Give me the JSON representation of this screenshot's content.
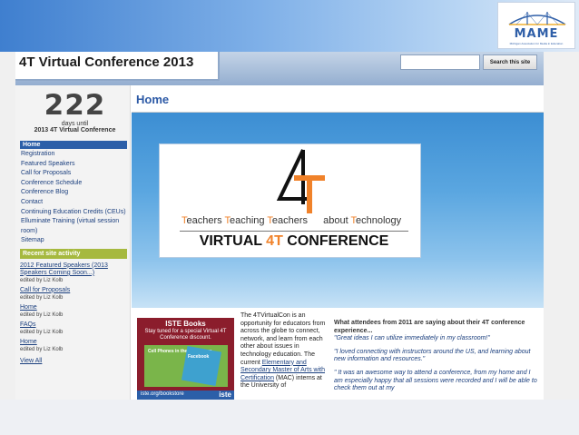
{
  "header": {
    "site_title": "4T Virtual Conference 2013",
    "search_placeholder": "",
    "search_button": "Search this site"
  },
  "logo": {
    "name": "MAME",
    "subtitle": "Michigan Association for Media in Education"
  },
  "countdown": {
    "number": "222",
    "line1": "days until",
    "line2": "2013 4T Virtual Conference"
  },
  "sidebar": {
    "nav_header": "Home",
    "items": [
      {
        "label": "Registration"
      },
      {
        "label": "Featured Speakers"
      },
      {
        "label": "Call for Proposals"
      },
      {
        "label": "Conference Schedule"
      },
      {
        "label": "Conference Blog"
      },
      {
        "label": "Contact"
      },
      {
        "label": "Continuing Education Credits (CEUs)"
      },
      {
        "label": "Elluminate Training (virtual session room)"
      },
      {
        "label": "Sitemap"
      }
    ],
    "recent_header": "Recent site activity",
    "recent": [
      {
        "title": "2012 Featured Speakers (2013 Speakers Coming Soon...)",
        "by": "edited by Liz Kolb"
      },
      {
        "title": "Call for Proposals",
        "by": "edited by Liz Kolb"
      },
      {
        "title": "Home",
        "by": "edited by Liz Kolb"
      },
      {
        "title": "FAQs",
        "by": "edited by Liz Kolb"
      },
      {
        "title": "Home",
        "by": "edited by Liz Kolb"
      }
    ],
    "view_all": "View All"
  },
  "main": {
    "page_title": "Home",
    "banner": {
      "tag_w1_initial": "T",
      "tag_w1_rest": "eachers ",
      "tag_w2_initial": "T",
      "tag_w2_rest": "eaching ",
      "tag_w3_initial": "T",
      "tag_w3_rest": "eachers ",
      "tag_w4_rest": "about ",
      "tag_w5_initial": "T",
      "tag_w5_rest": "echnology",
      "vc_left": "VIRTUAL ",
      "vc_accent": "4T",
      "vc_right": " CONFERENCE"
    },
    "ad": {
      "heading": "ISTE Books",
      "sub": "Stay tuned for a special Virtual 4T Conference discount.",
      "book1": "Cell Phones in the Classroom",
      "book2": "Facebook",
      "url": "iste.org/bookstore",
      "brand": "iste"
    },
    "intro": {
      "text1": "The 4TVirtualCon is an opportunity for educators from across the globe to connect, network, and learn from each other about issues in technology education.  The current ",
      "link": "Elementary and Secondary Master of Arts with Certification",
      "text2": " (MAC) interns at the University of"
    },
    "quotes": {
      "heading": "What attendees from 2011 are saying about their 4T conference experience...",
      "items": [
        "\"Great ideas I can utilize immediately in my classroom!\"",
        "\"I loved connecting with instructors around the US, and learning about new information and resources.\"",
        "\" It was an awesome way to attend a conference, from my home and I am especially happy that all sessions were recorded and I will be able to check them out at my"
      ]
    }
  },
  "colors": {
    "nav_header_bg": "#2c5fa8",
    "recent_header_bg": "#a6b93f",
    "accent_orange": "#f0822a",
    "link": "#1b3f7e"
  }
}
